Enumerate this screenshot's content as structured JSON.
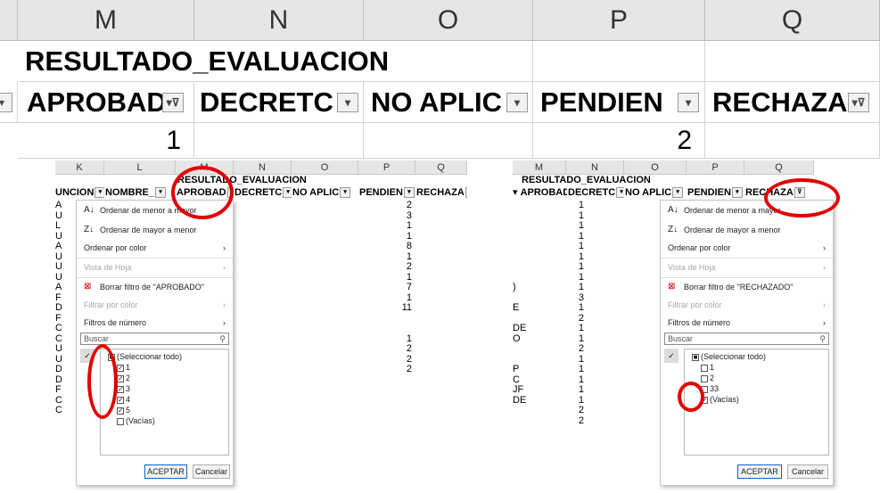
{
  "top": {
    "columns": [
      "M",
      "N",
      "O",
      "P",
      "Q"
    ],
    "title": "RESULTADO_EVALUACION",
    "headers": [
      "APROBAD",
      "DECRETC",
      "NO APLIC",
      "PENDIEN",
      "RECHAZA"
    ],
    "values": [
      "1",
      "",
      "",
      "2",
      ""
    ]
  },
  "left": {
    "columns": [
      "K",
      "L",
      "M",
      "N",
      "O",
      "P",
      "Q"
    ],
    "title": "RESULTADO_EVALUACION",
    "headers": [
      "UNCION",
      "NOMBRE_",
      "APROBAD",
      "DECRETC",
      "NO APLIC",
      "PENDIEN",
      "RECHAZA"
    ],
    "row_prefix": [
      "A",
      "U",
      "L",
      "U",
      "A",
      "U",
      "U",
      "U",
      "A",
      "F",
      "D",
      "F",
      "C",
      "C",
      "U",
      "U",
      "D",
      "D",
      "F",
      "C",
      "C"
    ],
    "p_values": [
      "2",
      "3",
      "1",
      "1",
      "8",
      "1",
      "2",
      "1",
      "7",
      "1",
      "11",
      "",
      "",
      "1",
      "2",
      "2",
      "2",
      "",
      "",
      "",
      ""
    ],
    "menu": {
      "sort_asc": "Ordenar de menor a mayor",
      "sort_desc": "Ordenar de mayor a menor",
      "sort_color": "Ordenar por color",
      "sheet_view": "Vista de Hoja",
      "clear_filter": "Borrar filtro de \"APROBADO\"",
      "filter_color": "Filtrar por color",
      "number_filters": "Filtros de número",
      "search_placeholder": "Buscar",
      "items": [
        "(Seleccionar todo)",
        "1",
        "2",
        "3",
        "4",
        "5",
        "(Vacías)"
      ],
      "ok": "ACEPTAR",
      "cancel": "Cancelar"
    }
  },
  "right": {
    "columns": [
      "M",
      "N",
      "O",
      "P",
      "Q"
    ],
    "title": "RESULTADO_EVALUACION",
    "headers": [
      "APROBAD",
      "DECRETC",
      "NO APLIC",
      "PENDIEN",
      "RECHAZA"
    ],
    "m_values": [
      "1",
      "1",
      "1",
      "1",
      "1",
      "1",
      "1",
      "1",
      "1",
      "3",
      "1",
      "2",
      "1",
      "1",
      "2",
      "1",
      "1",
      "1",
      "1",
      "1",
      "2",
      "2"
    ],
    "o_prefix": [
      "",
      "",
      "",
      "",
      "",
      "",
      "",
      "",
      ")",
      "",
      "E",
      "",
      "DE",
      "O",
      "",
      "",
      "P",
      "C",
      "JF",
      "DE",
      "",
      ""
    ],
    "menu": {
      "sort_asc": "Ordenar de menor a mayor",
      "sort_desc": "Ordenar de mayor a menor",
      "sort_color": "Ordenar por color",
      "sheet_view": "Vista de Hoja",
      "clear_filter": "Borrar filtro de \"RECHAZADO\"",
      "filter_color": "Filtrar por color",
      "number_filters": "Filtros de número",
      "search_placeholder": "Buscar",
      "items": [
        "(Seleccionar todo)",
        "1",
        "2",
        "33",
        "(Vacías)"
      ],
      "ok": "ACEPTAR",
      "cancel": "Cancelar"
    }
  },
  "colors": {
    "highlight_ring": "#e00000",
    "header_bg": "#e6e6e6"
  }
}
